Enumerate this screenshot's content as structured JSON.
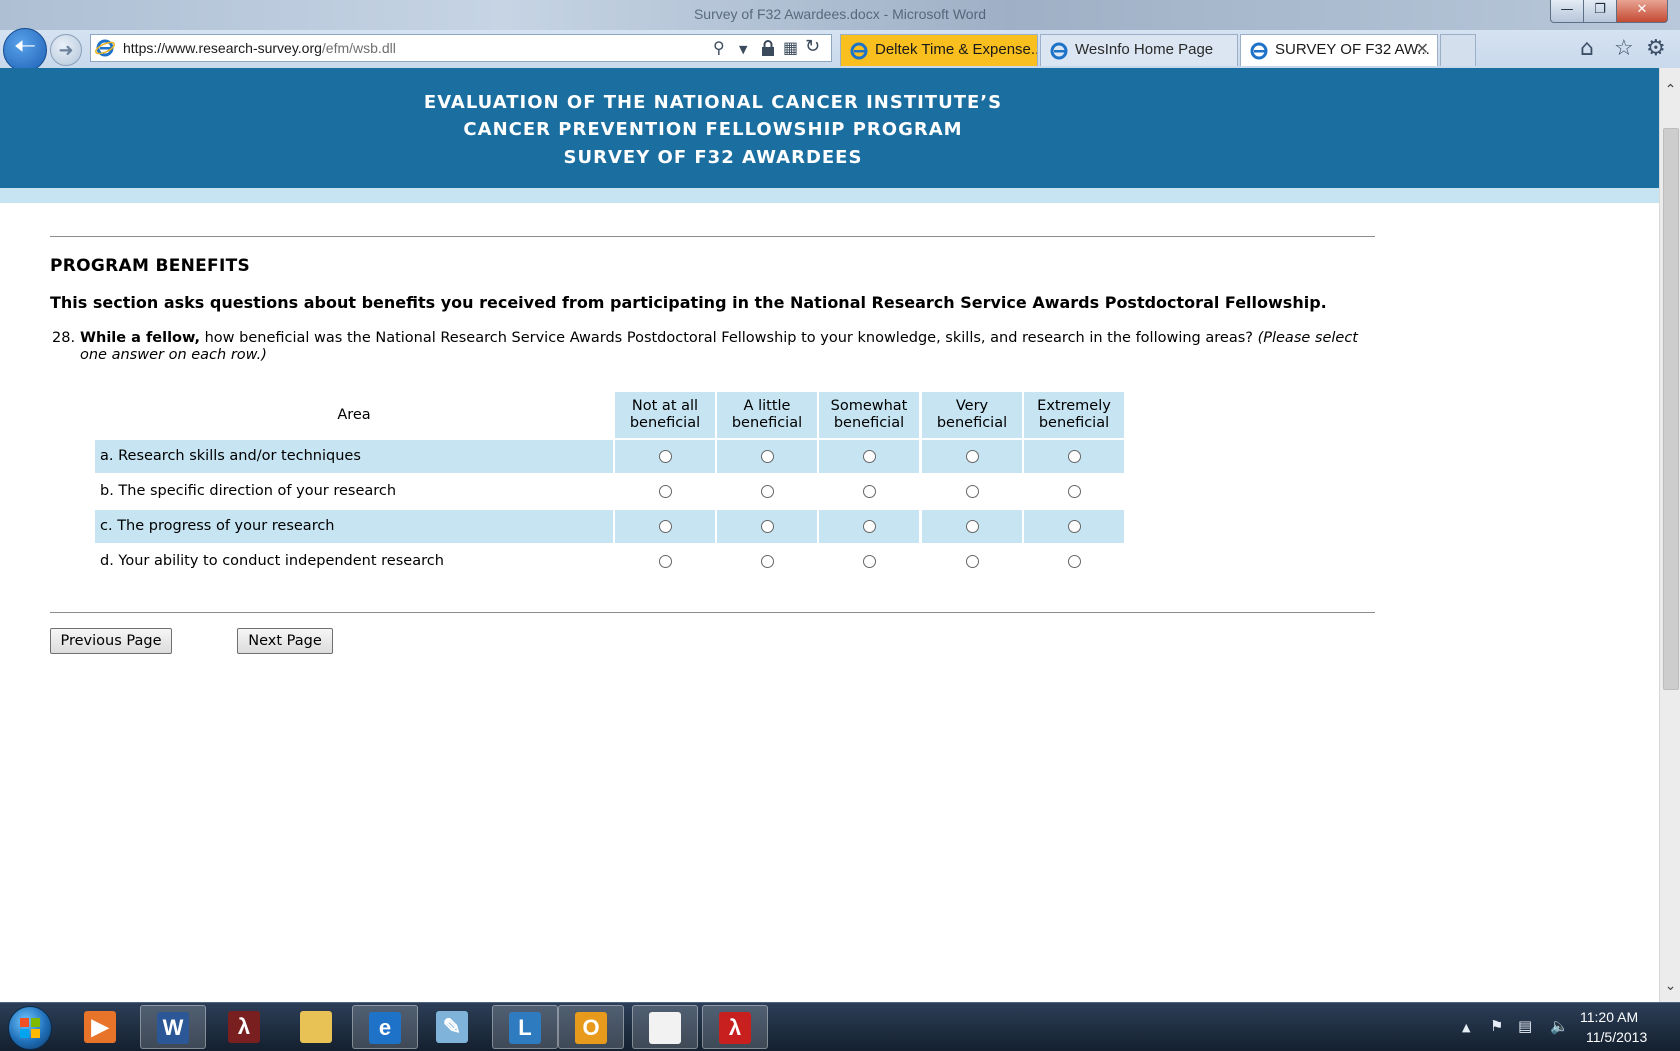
{
  "window": {
    "title": "Survey of F32 Awardees.docx - Microsoft Word"
  },
  "browser": {
    "url_host": "https://www.research-survey.org",
    "url_path": "/efm/wsb.dll",
    "tabs": [
      {
        "label": "Deltek Time & Expense..."
      },
      {
        "label": "WesInfo Home Page"
      },
      {
        "label": "SURVEY OF F32 AW...",
        "close": "✕"
      }
    ]
  },
  "banner": {
    "line1": "EVALUATION OF THE NATIONAL CANCER INSTITUTE’S",
    "line2": "CANCER PREVENTION FELLOWSHIP PROGRAM",
    "line3": "SURVEY OF F32 AWARDEES"
  },
  "section": {
    "title": "PROGRAM BENEFITS",
    "intro": "This section asks questions about benefits you received from participating in the National Research Service Awards Postdoctoral Fellowship."
  },
  "question": {
    "number": "28.",
    "lead": "While a fellow,",
    "text": " how beneficial was the National Research Service Awards Postdoctoral Fellowship to your knowledge, skills, and research in the following areas? ",
    "instruction": "(Please select one answer on each row.)"
  },
  "matrix": {
    "area_header": "Area",
    "columns": [
      {
        "line1": "Not at all",
        "line2": "beneficial"
      },
      {
        "line1": "A little",
        "line2": "beneficial"
      },
      {
        "line1": "Somewhat",
        "line2": "beneficial"
      },
      {
        "line1": "Very",
        "line2": "beneficial"
      },
      {
        "line1": "Extremely",
        "line2": "beneficial"
      }
    ],
    "rows": [
      {
        "label": "a. Research skills and/or techniques"
      },
      {
        "label": "b. The specific direction of your research"
      },
      {
        "label": "c. The progress of your research"
      },
      {
        "label": "d. Your ability to conduct independent research"
      }
    ]
  },
  "nav": {
    "previous": "Previous Page",
    "next": "Next Page"
  },
  "taskbar": {
    "apps": [
      "media-player-icon",
      "word-icon",
      "acrobat-icon",
      "folder-icon",
      "internet-explorer-icon",
      "notepad-icon",
      "lync-icon",
      "outlook-icon",
      "blank-document-icon",
      "pdf-reader-icon"
    ],
    "time": "11:20 AM",
    "date": "11/5/2013"
  },
  "colors": {
    "banner": "#1a6ea0",
    "shade": "#c6e4f2",
    "active_tab": "#f9bf1e"
  }
}
